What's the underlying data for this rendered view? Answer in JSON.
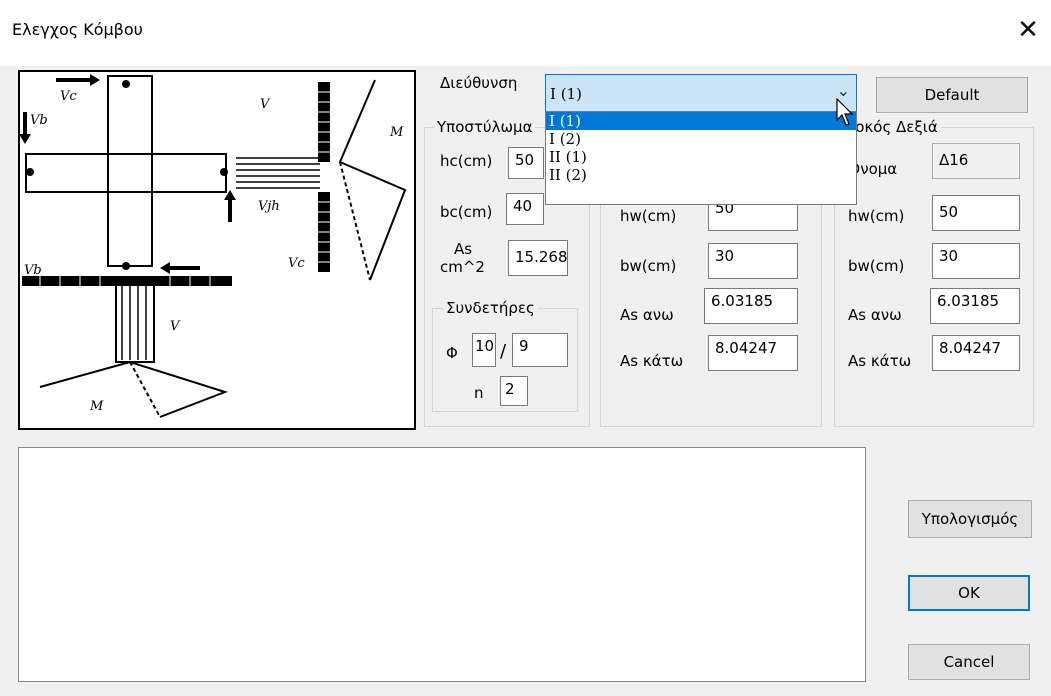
{
  "window": {
    "title": "Ελεγχος Κόμβου"
  },
  "figure": {
    "labels": {
      "vc": "Vc",
      "vb": "Vb",
      "v_top": "V",
      "m_right": "M",
      "vjh": "Vjh",
      "vc2": "Vc",
      "v_left": "Vb",
      "v_bottom": "V",
      "m_bottom": "M"
    }
  },
  "direction": {
    "label": "Διεύθυνση",
    "selected": "I (1)",
    "options": [
      "I (1)",
      "I (2)",
      "II (1)",
      "II (2)"
    ]
  },
  "default_button": "Default",
  "column": {
    "title": "Υποστύλωμα",
    "hc_label": "hc(cm)",
    "hc_value": "50",
    "bc_label": "bc(cm)",
    "bc_value": "40",
    "as_label_1": "As",
    "as_label_2": "cm^2",
    "as_value": "15.268",
    "stirrups": {
      "title": "Συνδετήρες",
      "phi_label": "Φ",
      "phi_value": "10",
      "slash": "/",
      "spacing_value": "9",
      "n_label": "n",
      "n_value": "2"
    }
  },
  "beam_left": {
    "hw_label": "hw(cm)",
    "hw_value": "50",
    "bw_label": "bw(cm)",
    "bw_value": "30",
    "as_top_label": "As ανω",
    "as_top_value": "6.03185",
    "as_bot_label": "As κάτω",
    "as_bot_value": "8.04247"
  },
  "beam_right": {
    "title": "Δοκός Δεξιά",
    "name_label": "Όνομα",
    "name_value": "Δ16",
    "hw_label": "hw(cm)",
    "hw_value": "50",
    "bw_label": "bw(cm)",
    "bw_value": "30",
    "as_top_label": "As ανω",
    "as_top_value": "6.03185",
    "as_bot_label": "As κάτω",
    "as_bot_value": "8.04247"
  },
  "buttons": {
    "calculate": "Υπολογισμός",
    "ok": "OK",
    "cancel": "Cancel"
  },
  "results": {
    "text": ""
  }
}
